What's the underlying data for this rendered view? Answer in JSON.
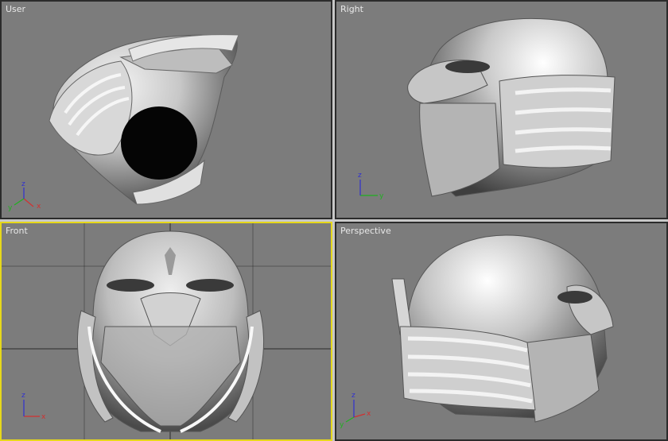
{
  "viewports": {
    "user": {
      "label": "User",
      "active": false
    },
    "right": {
      "label": "Right",
      "active": false
    },
    "front": {
      "label": "Front",
      "active": true
    },
    "perspective": {
      "label": "Perspective",
      "active": false
    }
  },
  "axes": {
    "x": "x",
    "y": "y",
    "z": "z"
  },
  "colors": {
    "viewport_bg": "#7c7c7c",
    "active_border": "#e6d81a",
    "axis_x": "#d23030",
    "axis_y": "#20b020",
    "axis_z": "#3030d0",
    "grid": "#2a2a2a"
  }
}
